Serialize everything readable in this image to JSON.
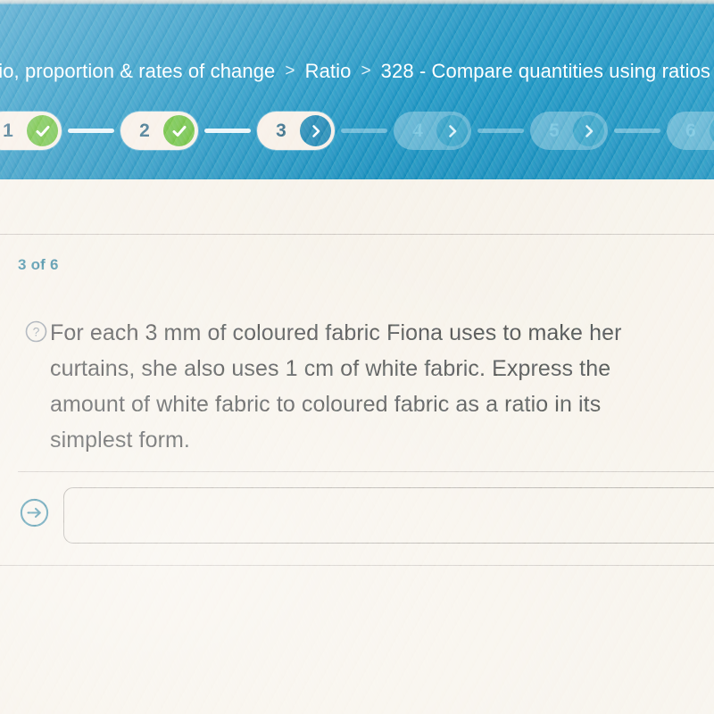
{
  "header": {
    "breadcrumb": {
      "name": "breadcrumb",
      "leading_truncated": "tio, proportion & rates of change",
      "separator": ">",
      "items": [
        {
          "label": "tio, proportion & rates of change"
        },
        {
          "label": "Ratio"
        },
        {
          "label": "328 - Compare quantities using ratios"
        }
      ],
      "trailing_separator": ">"
    },
    "stepper": {
      "steps": [
        {
          "number": "1",
          "state": "done",
          "icon": "check-icon"
        },
        {
          "number": "2",
          "state": "done",
          "icon": "check-icon"
        },
        {
          "number": "3",
          "state": "current",
          "icon": "chevron-right-icon"
        },
        {
          "number": "4",
          "state": "todo",
          "icon": "chevron-right-icon"
        },
        {
          "number": "5",
          "state": "todo",
          "icon": "chevron-right-icon"
        },
        {
          "number": "6",
          "state": "todo",
          "icon": "chevron-right-icon"
        }
      ]
    }
  },
  "main": {
    "counter": "3 of 6",
    "question": {
      "icon": "question-mark-icon",
      "text": "For each 3 mm of coloured fabric Fiona uses to make her curtains, she also uses 1 cm of white fabric. Express the amount of white fabric to coloured fabric as a ratio in its simplest form."
    },
    "answer": {
      "icon": "arrow-right-circle-icon",
      "value": "",
      "placeholder": ""
    }
  },
  "colors": {
    "header_blue": "#0f8dbe",
    "page_bg": "#f6f1e8",
    "pill_cream": "#f7eee5",
    "done_green": "#5fbb2e",
    "current_blue": "#127fae",
    "teal_accent": "#2b7f99",
    "text_dark": "#3a3a3a"
  }
}
